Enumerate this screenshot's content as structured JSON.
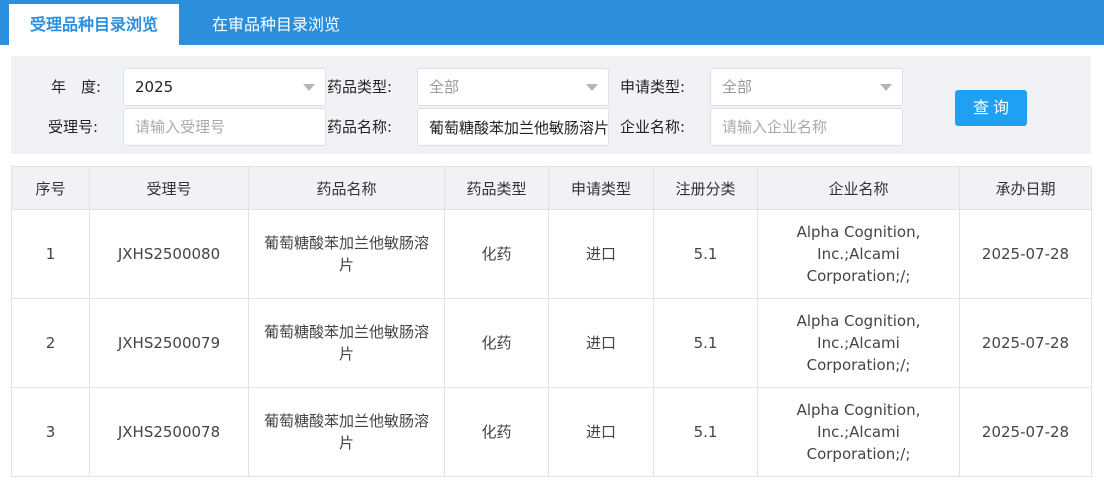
{
  "tabs": [
    {
      "label": "受理品种目录浏览",
      "active": true
    },
    {
      "label": "在审品种目录浏览",
      "active": false
    }
  ],
  "filters": {
    "year": {
      "label": "年　度:",
      "value": "2025"
    },
    "drug_type": {
      "label": "药品类型:",
      "value": "全部"
    },
    "apply_type": {
      "label": "申请类型:",
      "value": "全部"
    },
    "accept_no": {
      "label": "受理号:",
      "placeholder": "请输入受理号",
      "value": ""
    },
    "drug_name": {
      "label": "药品名称:",
      "value": "葡萄糖酸苯加兰他敏肠溶片"
    },
    "company": {
      "label": "企业名称:",
      "placeholder": "请输入企业名称",
      "value": ""
    },
    "query_label": "查询"
  },
  "table": {
    "headers": [
      "序号",
      "受理号",
      "药品名称",
      "药品类型",
      "申请类型",
      "注册分类",
      "企业名称",
      "承办日期"
    ],
    "rows": [
      [
        "1",
        "JXHS2500080",
        "葡萄糖酸苯加兰他敏肠溶片",
        "化药",
        "进口",
        "5.1",
        "Alpha Cognition, Inc.;Alcami Corporation;/;",
        "2025-07-28"
      ],
      [
        "2",
        "JXHS2500079",
        "葡萄糖酸苯加兰他敏肠溶片",
        "化药",
        "进口",
        "5.1",
        "Alpha Cognition, Inc.;Alcami Corporation;/;",
        "2025-07-28"
      ],
      [
        "3",
        "JXHS2500078",
        "葡萄糖酸苯加兰他敏肠溶片",
        "化药",
        "进口",
        "5.1",
        "Alpha Cognition, Inc.;Alcami Corporation;/;",
        "2025-07-28"
      ]
    ]
  },
  "colors": {
    "accent": "#2b8fdd",
    "button": "#1ea1f2",
    "panel": "#f0f2f5"
  }
}
